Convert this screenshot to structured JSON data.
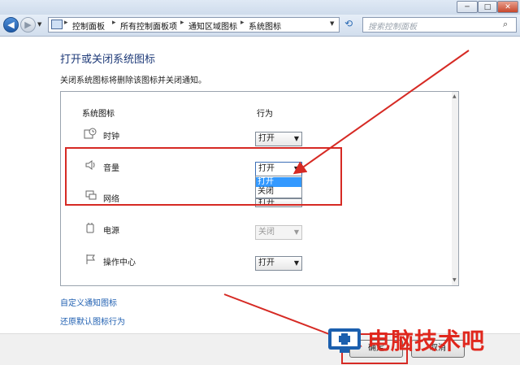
{
  "window": {
    "controls": {
      "minimize": "─",
      "maximize": "□",
      "close": "✕"
    }
  },
  "navbar": {
    "breadcrumbs": [
      "控制面板",
      "所有控制面板项",
      "通知区域图标",
      "系统图标"
    ],
    "search_placeholder": "搜索控制面板",
    "icons": {
      "back": "back-arrow-icon",
      "forward": "forward-arrow-icon",
      "refresh": "refresh-icon",
      "search": "search-icon"
    }
  },
  "page": {
    "heading": "打开或关闭系统图标",
    "description": "关闭系统图标将删除该图标并关闭通知。",
    "columns": {
      "icon": "系统图标",
      "behavior": "行为"
    },
    "rows": [
      {
        "label": "时钟",
        "icon": "clock-icon",
        "value": "打开",
        "disabled": false
      },
      {
        "label": "音量",
        "icon": "volume-icon",
        "value": "打开",
        "disabled": false,
        "open": true
      },
      {
        "label": "网络",
        "icon": "network-icon",
        "value": "打开",
        "disabled": false
      },
      {
        "label": "电源",
        "icon": "power-icon",
        "value": "关闭",
        "disabled": true
      },
      {
        "label": "操作中心",
        "icon": "flag-icon",
        "value": "打开",
        "disabled": false
      }
    ],
    "dropdown_options": [
      "打开",
      "关闭"
    ],
    "dropdown_selected": "打开",
    "links": {
      "customize": "自定义通知图标",
      "restore": "还原默认图标行为"
    }
  },
  "footer": {
    "ok": "确定",
    "cancel": "取消"
  },
  "watermark": {
    "text": "电脑技术吧"
  },
  "colors": {
    "annotation_red": "#d62a24",
    "link": "#1f5fb1",
    "heading": "#1e3a78",
    "highlight": "#3399ff"
  }
}
